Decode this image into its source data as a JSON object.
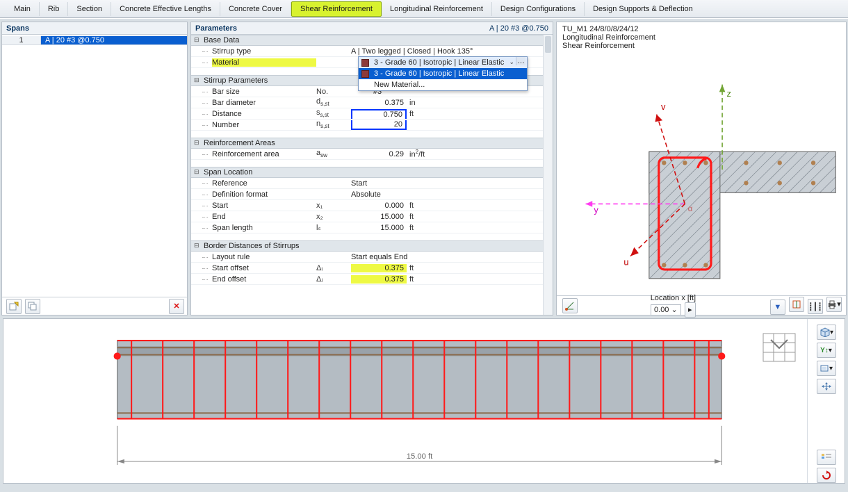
{
  "tabs": {
    "main": "Main",
    "rib": "Rib",
    "section": "Section",
    "cel": "Concrete Effective Lengths",
    "cc": "Concrete Cover",
    "sr": "Shear Reinforcement",
    "lr": "Longitudinal Reinforcement",
    "dc": "Design Configurations",
    "dsd": "Design Supports & Deflection"
  },
  "spans": {
    "header": "Spans",
    "row_idx": "1",
    "row_txt": "A | 20 #3 @0.750"
  },
  "params": {
    "header_left": "Parameters",
    "header_right": "A | 20 #3 @0.750",
    "base": {
      "title": "Base Data",
      "stirrup_type_lbl": "Stirrup type",
      "stirrup_type_val": "A | Two legged | Closed | Hook 135°",
      "material_lbl": "Material",
      "dd_current": "3 - Grade 60 | Isotropic | Linear Elastic",
      "dd_opt": "3 - Grade 60 | Isotropic | Linear Elastic",
      "dd_new": "New Material..."
    },
    "stirrup": {
      "title": "Stirrup Parameters",
      "barsize_lbl": "Bar size",
      "barsize_sym": "No.",
      "barsize_val": "#3",
      "bardia_lbl": "Bar diameter",
      "bardia_val": "0.375",
      "bardia_unit": "in",
      "dist_lbl": "Distance",
      "dist_val": "0.750",
      "dist_unit": "ft",
      "num_lbl": "Number",
      "num_val": "20"
    },
    "areas": {
      "title": "Reinforcement Areas",
      "area_lbl": "Reinforcement area",
      "area_sym": "a",
      "area_sw": "sw",
      "area_val": "0.29",
      "area_unit": "in²/ft"
    },
    "span": {
      "title": "Span Location",
      "ref_lbl": "Reference",
      "ref_val": "Start",
      "def_lbl": "Definition format",
      "def_val": "Absolute",
      "start_lbl": "Start",
      "start_sym": "x₁",
      "start_val": "0.000",
      "start_unit": "ft",
      "end_lbl": "End",
      "end_sym": "x₂",
      "end_val": "15.000",
      "end_unit": "ft",
      "len_lbl": "Span length",
      "len_sym": "lₛ",
      "len_val": "15.000",
      "len_unit": "ft"
    },
    "border": {
      "title": "Border Distances of Stirrups",
      "rule_lbl": "Layout rule",
      "rule_val": "Start equals End",
      "so_lbl": "Start offset",
      "so_sym": "Δᵢ",
      "so_val": "0.375",
      "so_unit": "ft",
      "eo_lbl": "End offset",
      "eo_sym": "Δⱼ",
      "eo_val": "0.375",
      "eo_unit": "ft"
    }
  },
  "preview": {
    "title": "TU_M1 24/8/0/8/24/12",
    "line2": "Longitudinal Reinforcement",
    "line3": "Shear Reinforcement",
    "loc_label": "Location x [ft]",
    "loc_val": "0.00",
    "axis_v": "v",
    "axis_u": "u",
    "axis_y": "y",
    "axis_z": "z"
  },
  "beam": {
    "length": "15.00 ft"
  }
}
